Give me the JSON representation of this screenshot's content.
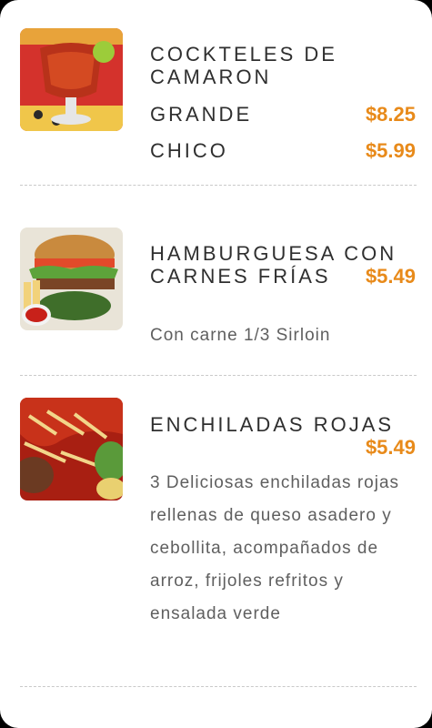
{
  "menu": {
    "items": [
      {
        "image_label": "shrimp-cocktail-image",
        "title": "COCKTELES DE CAMARON",
        "variants": [
          {
            "label": "GRANDE",
            "price": "$8.25"
          },
          {
            "label": "CHICO",
            "price": "$5.99"
          }
        ]
      },
      {
        "image_label": "hamburger-image",
        "title": "HAMBURGUESA CON CARNES FRÍAS",
        "price": "$5.49",
        "description": "Con carne 1/3 Sirloin"
      },
      {
        "image_label": "enchiladas-image",
        "title": "ENCHILADAS ROJAS",
        "price": "$5.49",
        "description": "3 Deliciosas enchiladas rojas rellenas de queso asadero y cebollita, acompañados de arroz, frijoles refritos y ensalada verde"
      }
    ]
  },
  "colors": {
    "price": "#e88a1a",
    "title": "#2f2f2f",
    "description": "#5f5f5f"
  }
}
